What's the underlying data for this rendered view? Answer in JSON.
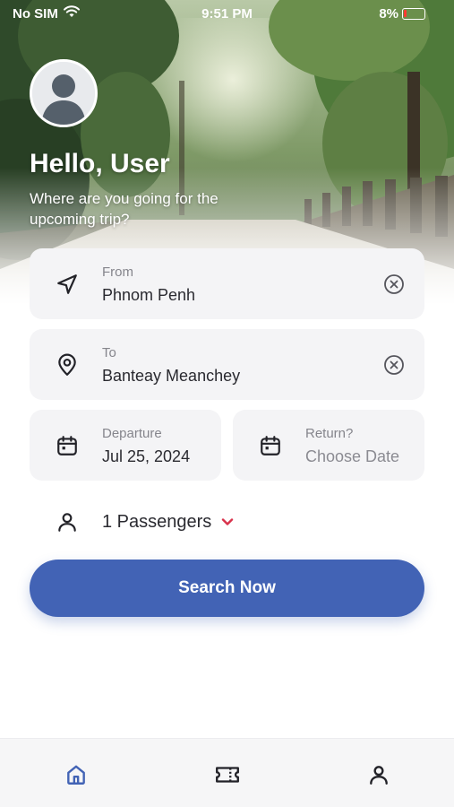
{
  "status_bar": {
    "carrier": "No SIM",
    "time": "9:51 PM",
    "battery": "8%"
  },
  "greeting": {
    "title": "Hello, User",
    "subtitle": "Where are you going for the upcoming trip?"
  },
  "form": {
    "from": {
      "label": "From",
      "value": "Phnom Penh",
      "icon": "navigation-arrow-icon"
    },
    "to": {
      "label": "To",
      "value": "Banteay Meanchey",
      "icon": "map-pin-icon"
    },
    "departure": {
      "label": "Departure",
      "value": "Jul 25, 2024",
      "icon": "calendar-icon"
    },
    "return": {
      "label": "Return?",
      "value": "Choose Date",
      "icon": "calendar-icon"
    },
    "passengers": {
      "label": "1 Passengers",
      "icon": "user-icon"
    }
  },
  "search_button": {
    "label": "Search Now"
  },
  "tab_bar": {
    "tabs": [
      {
        "name": "home",
        "icon": "home-icon",
        "active": true
      },
      {
        "name": "tickets",
        "icon": "ticket-icon",
        "active": false
      },
      {
        "name": "profile",
        "icon": "user-icon",
        "active": false
      }
    ]
  },
  "colors": {
    "primary": "#4263b5",
    "card_bg": "#f4f4f6",
    "chevron": "#d8324b",
    "icon": "#222228"
  }
}
